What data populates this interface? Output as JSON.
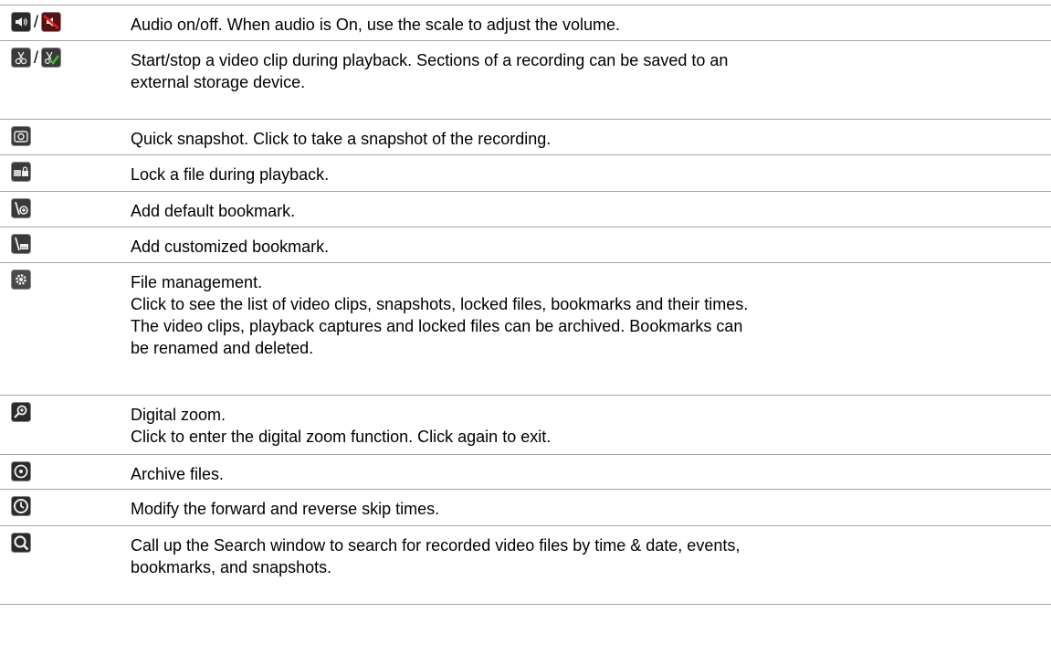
{
  "rows": [
    {
      "icons": [
        "speaker-icon",
        "speaker-muted-icon"
      ],
      "separator": "/",
      "lines": [
        "Audio on/off. When audio is On, use the scale to adjust the volume."
      ]
    },
    {
      "icons": [
        "scissors-icon",
        "scissors-check-icon"
      ],
      "separator": "/",
      "lines": [
        "Start/stop a video clip during playback. Sections of a recording can be saved to an",
        "external storage device."
      ]
    },
    {
      "icons": [
        "camera-icon"
      ],
      "lines": [
        "Quick snapshot. Click to take a snapshot of the recording."
      ]
    },
    {
      "icons": [
        "lock-file-icon"
      ],
      "lines": [
        "Lock a file during playback."
      ]
    },
    {
      "icons": [
        "bookmark-add-icon"
      ],
      "lines": [
        "Add default bookmark."
      ]
    },
    {
      "icons": [
        "bookmark-custom-icon"
      ],
      "lines": [
        "Add customized bookmark."
      ]
    },
    {
      "icons": [
        "gear-icon"
      ],
      "lines": [
        "File management.",
        "Click to see the list of video clips, snapshots, locked files, bookmarks and their times.",
        "The video clips, playback captures and locked files can be archived. Bookmarks can",
        "be renamed and deleted."
      ]
    },
    {
      "icons": [
        "zoom-icon"
      ],
      "lines": [
        "Digital zoom.",
        "Click to enter the digital zoom function. Click again to exit."
      ]
    },
    {
      "icons": [
        "disc-icon"
      ],
      "lines": [
        "Archive files."
      ]
    },
    {
      "icons": [
        "clock-icon"
      ],
      "lines": [
        "Modify the forward and reverse skip times."
      ]
    },
    {
      "icons": [
        "search-icon"
      ],
      "lines": [
        "Call up the Search window to search for recorded video files by time & date, events,",
        "bookmarks, and snapshots."
      ]
    }
  ]
}
